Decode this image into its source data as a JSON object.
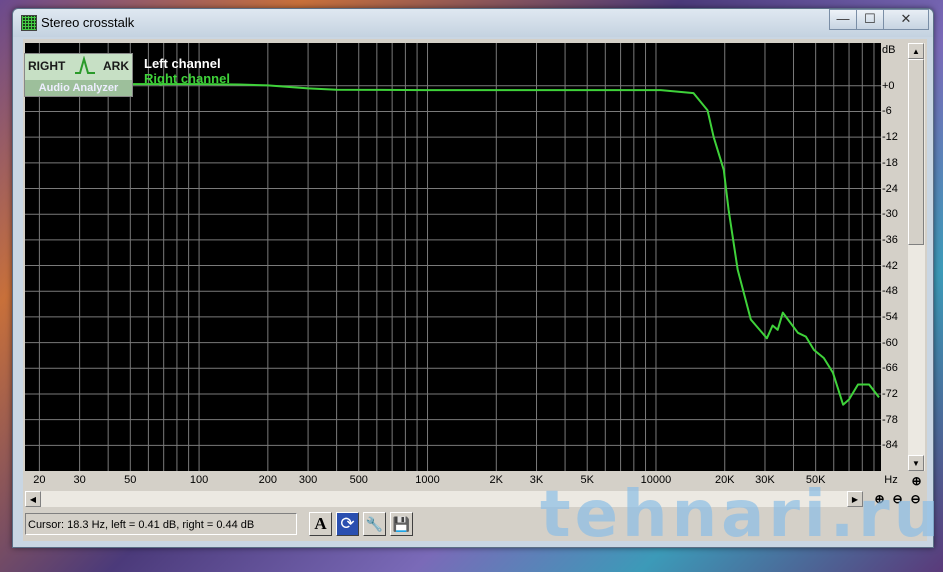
{
  "window": {
    "title": "Stereo crosstalk",
    "minimize": "—",
    "maximize": "☐",
    "close": "✕"
  },
  "logo": {
    "line1a": "RIGHT",
    "line1b": "ARK",
    "line2": "Audio Analyzer"
  },
  "status": {
    "cursor": "Cursor:  18.3 Hz,  left = 0.41 dB,  right = 0.44 dB"
  },
  "toolbar": {
    "font": "A",
    "refresh": "⟳",
    "settings": "🔧",
    "save": "💾"
  },
  "watermark": "tehnari.ru",
  "colors": {
    "plot_bg": "#000000",
    "grid": "#7a7a7a",
    "left": "#ffffff",
    "right": "#3fd23a"
  },
  "chart_data": {
    "type": "line",
    "title": "Stereo crosstalk",
    "xlabel": "Hz",
    "ylabel": "dB",
    "xscale": "log",
    "xlim": [
      17.3,
      96600
    ],
    "ylim": [
      -90,
      10
    ],
    "x_ticks": [
      {
        "v": 20,
        "l": "20"
      },
      {
        "v": 30,
        "l": "30"
      },
      {
        "v": 50,
        "l": "50"
      },
      {
        "v": 100,
        "l": "100"
      },
      {
        "v": 200,
        "l": "200"
      },
      {
        "v": 300,
        "l": "300"
      },
      {
        "v": 500,
        "l": "500"
      },
      {
        "v": 1000,
        "l": "1000"
      },
      {
        "v": 2000,
        "l": "2K"
      },
      {
        "v": 3000,
        "l": "3K"
      },
      {
        "v": 5000,
        "l": "5K"
      },
      {
        "v": 10000,
        "l": "10000"
      },
      {
        "v": 20000,
        "l": "20K"
      },
      {
        "v": 30000,
        "l": "30K"
      },
      {
        "v": 50000,
        "l": "50K"
      }
    ],
    "y_ticks": [
      {
        "v": 0,
        "l": "+0"
      },
      {
        "v": -6,
        "l": "-6"
      },
      {
        "v": -12,
        "l": "-12"
      },
      {
        "v": -18,
        "l": "-18"
      },
      {
        "v": -24,
        "l": "-24"
      },
      {
        "v": -30,
        "l": "-30"
      },
      {
        "v": -36,
        "l": "-36"
      },
      {
        "v": -42,
        "l": "-42"
      },
      {
        "v": -48,
        "l": "-48"
      },
      {
        "v": -54,
        "l": "-54"
      },
      {
        "v": -60,
        "l": "-60"
      },
      {
        "v": -66,
        "l": "-66"
      },
      {
        "v": -72,
        "l": "-72"
      },
      {
        "v": -78,
        "l": "-78"
      },
      {
        "v": -84,
        "l": "-84"
      }
    ],
    "grid": true,
    "legend_position": "top-left",
    "series": [
      {
        "name": "Left channel",
        "color": "#ffffff",
        "x": [],
        "y": []
      },
      {
        "name": "Right channel",
        "color": "#3fd23a",
        "x": [
          17.3,
          50,
          100,
          150,
          200,
          300,
          400,
          1000,
          5000,
          10500,
          14600,
          16800,
          17900,
          19800,
          20800,
          22800,
          26000,
          30600,
          32400,
          34100,
          35900,
          41800,
          45300,
          49100,
          54300,
          59500,
          65900,
          70000,
          76600,
          85700,
          94700
        ],
        "y": [
          0.4,
          0.4,
          0.4,
          0.3,
          0.1,
          -0.6,
          -0.9,
          -1.0,
          -1.0,
          -1.0,
          -1.7,
          -5.7,
          -12,
          -19.7,
          -29,
          -43,
          -54.6,
          -59,
          -56,
          -57,
          -53,
          -57.7,
          -58.6,
          -61.7,
          -63.6,
          -67,
          -74.5,
          -73.3,
          -69.8,
          -69.8,
          -72.8
        ]
      }
    ]
  }
}
